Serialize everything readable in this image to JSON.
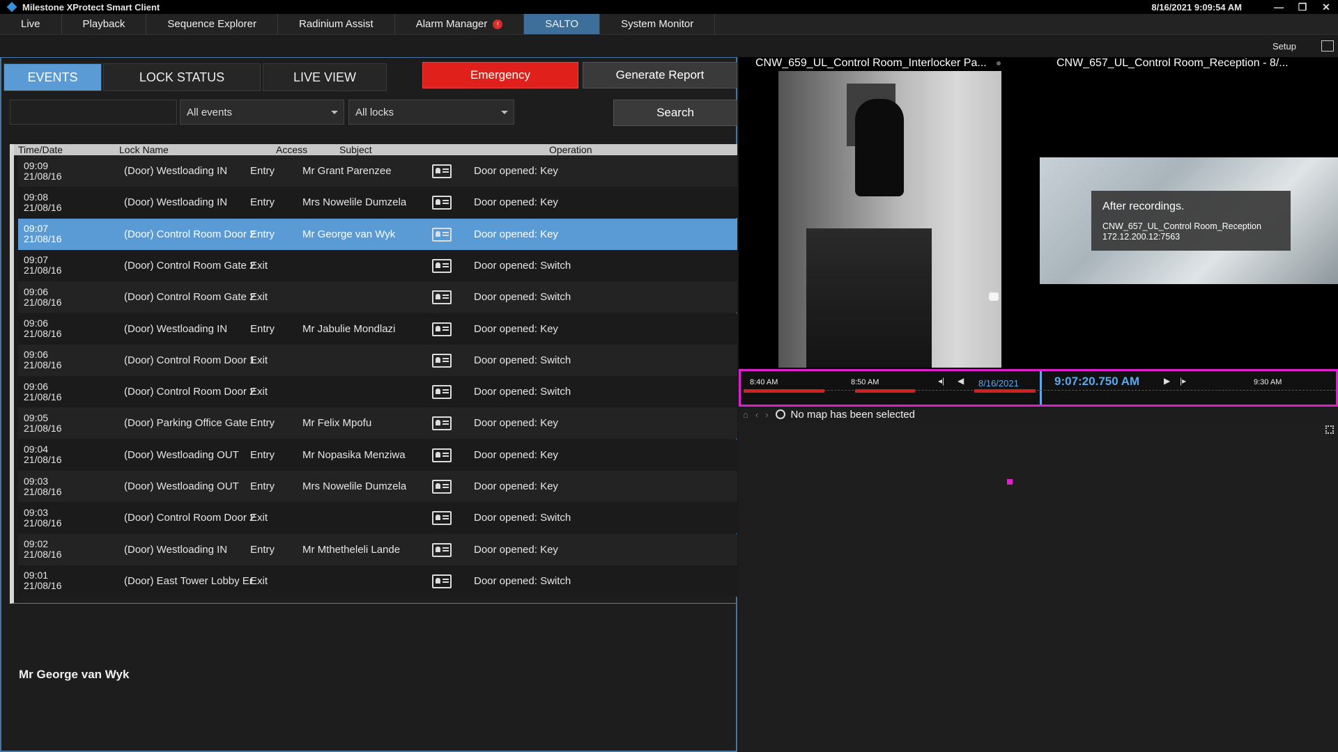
{
  "window": {
    "title": "Milestone XProtect Smart Client",
    "datetime": "8/16/2021 9:09:54 AM",
    "controls": [
      "—",
      "❐",
      "✕"
    ]
  },
  "menu": {
    "items": [
      "Live",
      "Playback",
      "Sequence Explorer",
      "Radinium Assist",
      "Alarm Manager",
      "SALTO",
      "System Monitor"
    ],
    "active": "SALTO",
    "alarm_badge": "!"
  },
  "subbar": {
    "setup": "Setup"
  },
  "salto": {
    "tabs": [
      "EVENTS",
      "LOCK STATUS",
      "LIVE VIEW"
    ],
    "emergency": "Emergency",
    "generate_report": "Generate Report",
    "filter_value": "",
    "events_select": "All events",
    "locks_select": "All locks",
    "search": "Search",
    "columns": [
      "Time/Date",
      "Lock Name",
      "Access",
      "Subject",
      "Operation"
    ],
    "rows": [
      {
        "time": "09:09",
        "date": "21/08/16",
        "lock": "(Door) Westloading IN",
        "access": "Entry",
        "subject": "Mr Grant Parenzee",
        "op": "Door opened: Key"
      },
      {
        "time": "09:08",
        "date": "21/08/16",
        "lock": "(Door) Westloading IN",
        "access": "Entry",
        "subject": "Mrs Nowelile Dumzela",
        "op": "Door opened: Key"
      },
      {
        "time": "09:07",
        "date": "21/08/16",
        "lock": "(Door) Control Room Door 2",
        "access": "Entry",
        "subject": "Mr George van Wyk",
        "op": "Door opened: Key",
        "selected": true
      },
      {
        "time": "09:07",
        "date": "21/08/16",
        "lock": "(Door) Control Room Gate 2",
        "access": "Exit",
        "subject": "",
        "op": "Door opened: Switch"
      },
      {
        "time": "09:06",
        "date": "21/08/16",
        "lock": "(Door) Control Room Gate 2",
        "access": "Exit",
        "subject": "",
        "op": "Door opened: Switch"
      },
      {
        "time": "09:06",
        "date": "21/08/16",
        "lock": "(Door) Westloading IN",
        "access": "Entry",
        "subject": "Mr Jabulie Mondlazi",
        "op": "Door opened: Key"
      },
      {
        "time": "09:06",
        "date": "21/08/16",
        "lock": "(Door) Control Room Door 1",
        "access": "Exit",
        "subject": "",
        "op": "Door opened: Switch"
      },
      {
        "time": "09:06",
        "date": "21/08/16",
        "lock": "(Door) Control Room Door 2",
        "access": "Exit",
        "subject": "",
        "op": "Door opened: Switch"
      },
      {
        "time": "09:05",
        "date": "21/08/16",
        "lock": "(Door) Parking Office Gate",
        "access": "Entry",
        "subject": "Mr Felix Mpofu",
        "op": "Door opened: Key"
      },
      {
        "time": "09:04",
        "date": "21/08/16",
        "lock": "(Door) Westloading OUT",
        "access": "Entry",
        "subject": "Mr Nopasika Menziwa",
        "op": "Door opened: Key"
      },
      {
        "time": "09:03",
        "date": "21/08/16",
        "lock": "(Door) Westloading OUT",
        "access": "Entry",
        "subject": "Mrs Nowelile Dumzela",
        "op": "Door opened: Key"
      },
      {
        "time": "09:03",
        "date": "21/08/16",
        "lock": "(Door) Control Room Door 2",
        "access": "Exit",
        "subject": "",
        "op": "Door opened: Switch"
      },
      {
        "time": "09:02",
        "date": "21/08/16",
        "lock": "(Door) Westloading IN",
        "access": "Entry",
        "subject": "Mr Mthetheleli Lande",
        "op": "Door opened: Key"
      },
      {
        "time": "09:01",
        "date": "21/08/16",
        "lock": "(Door) East Tower Lobby Er",
        "access": "Exit",
        "subject": "",
        "op": "Door opened: Switch"
      }
    ],
    "selected_subject": "Mr George van Wyk"
  },
  "cameras": {
    "cam1_title": "CNW_659_UL_Control Room_Interlocker Pa...",
    "cam2_title": "CNW_657_UL_Control Room_Reception - 8/...",
    "overlay_heading": "After recordings.",
    "overlay_name": "CNW_657_UL_Control Room_Reception",
    "overlay_ip": "172.12.200.12:7563"
  },
  "timeline": {
    "labels": [
      "8:40 AM",
      "8:50 AM",
      "9:30 AM"
    ],
    "date": "8/16/2021",
    "time": "9:07:20.750 AM",
    "colors": {
      "accent": "#5ea8ee",
      "highlight": "#e020d0",
      "recording": "#d22020"
    }
  },
  "map": {
    "message": "No map has been selected"
  },
  "icons": [
    "app-logo-icon",
    "alarm-badge-icon",
    "card-icon",
    "home-icon",
    "back-icon",
    "forward-icon",
    "globe-icon",
    "grid-icon",
    "window-icon",
    "help-icon",
    "key-icon",
    "chevron-down-icon"
  ]
}
